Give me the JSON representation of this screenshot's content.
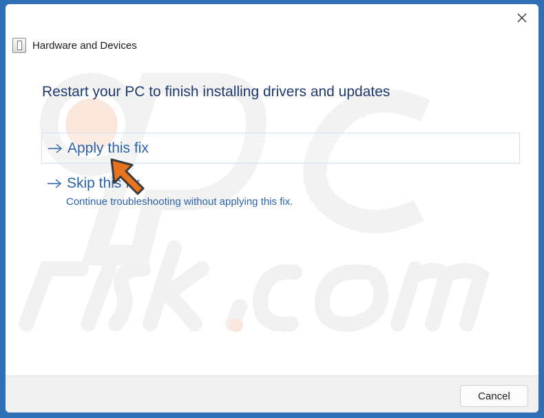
{
  "window": {
    "app_title": "Hardware and Devices",
    "close_icon": "close-icon"
  },
  "main": {
    "heading": "Restart your PC to finish installing drivers and updates",
    "options": [
      {
        "label": "Apply this fix",
        "icon": "arrow-right-icon"
      },
      {
        "label": "Skip this fix",
        "description": "Continue troubleshooting without applying this fix.",
        "icon": "arrow-right-icon"
      }
    ]
  },
  "footer": {
    "cancel_label": "Cancel"
  },
  "colors": {
    "accent_text": "#2a62ad",
    "heading_text": "#1d3a70",
    "cursor_arrow": "#e8731f",
    "watermark": "#eeeeee",
    "watermark_accent": "#fbe6dc"
  }
}
